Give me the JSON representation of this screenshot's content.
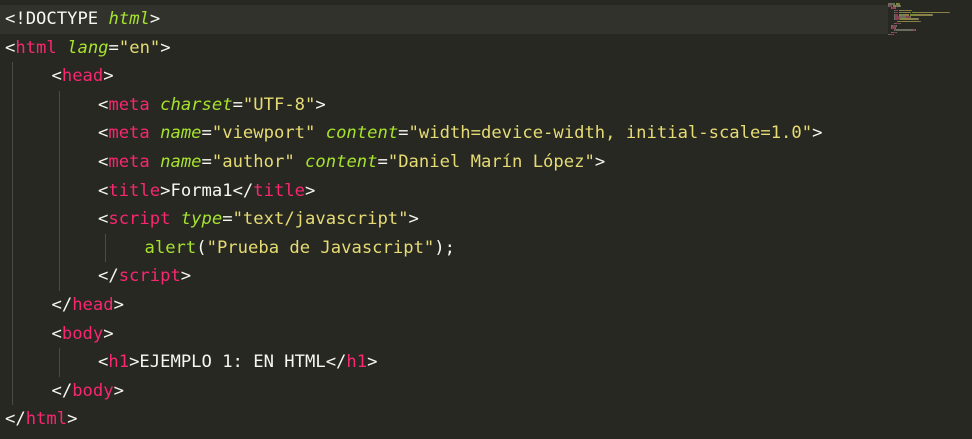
{
  "editor": {
    "language": "html",
    "theme_colors": {
      "background": "#272822",
      "tag": "#f92672",
      "attribute": "#a6e22e",
      "string": "#e6db74",
      "text": "#f8f8f2",
      "indent_guide": "#4a4b45"
    },
    "lines": [
      {
        "indent": 0,
        "tokens": [
          [
            "punct",
            "<"
          ],
          [
            "doctype",
            "!DOCTYPE"
          ],
          [
            "punct",
            " "
          ],
          [
            "attr",
            "html"
          ],
          [
            "punct",
            ">"
          ]
        ]
      },
      {
        "indent": 0,
        "tokens": [
          [
            "punct",
            "<"
          ],
          [
            "tag",
            "html"
          ],
          [
            "punct",
            " "
          ],
          [
            "attr",
            "lang"
          ],
          [
            "punct",
            "="
          ],
          [
            "str",
            "\"en\""
          ],
          [
            "punct",
            ">"
          ]
        ]
      },
      {
        "indent": 1,
        "tokens": [
          [
            "punct",
            "<"
          ],
          [
            "tag",
            "head"
          ],
          [
            "punct",
            ">"
          ]
        ]
      },
      {
        "indent": 2,
        "tokens": [
          [
            "punct",
            "<"
          ],
          [
            "tag",
            "meta"
          ],
          [
            "punct",
            " "
          ],
          [
            "attr",
            "charset"
          ],
          [
            "punct",
            "="
          ],
          [
            "str",
            "\"UTF-8\""
          ],
          [
            "punct",
            ">"
          ]
        ]
      },
      {
        "indent": 2,
        "tokens": [
          [
            "punct",
            "<"
          ],
          [
            "tag",
            "meta"
          ],
          [
            "punct",
            " "
          ],
          [
            "attr",
            "name"
          ],
          [
            "punct",
            "="
          ],
          [
            "str",
            "\"viewport\""
          ],
          [
            "punct",
            " "
          ],
          [
            "attr",
            "content"
          ],
          [
            "punct",
            "="
          ],
          [
            "str",
            "\"width=device-width, initial-scale=1.0\""
          ],
          [
            "punct",
            ">"
          ]
        ]
      },
      {
        "indent": 2,
        "tokens": [
          [
            "punct",
            "<"
          ],
          [
            "tag",
            "meta"
          ],
          [
            "punct",
            " "
          ],
          [
            "attr",
            "name"
          ],
          [
            "punct",
            "="
          ],
          [
            "str",
            "\"author\""
          ],
          [
            "punct",
            " "
          ],
          [
            "attr",
            "content"
          ],
          [
            "punct",
            "="
          ],
          [
            "str",
            "\"Daniel Marín López\""
          ],
          [
            "punct",
            ">"
          ]
        ]
      },
      {
        "indent": 2,
        "tokens": [
          [
            "punct",
            "<"
          ],
          [
            "tag",
            "title"
          ],
          [
            "punct",
            ">"
          ],
          [
            "text",
            "Forma1"
          ],
          [
            "punct",
            "</"
          ],
          [
            "tag",
            "title"
          ],
          [
            "punct",
            ">"
          ]
        ]
      },
      {
        "indent": 2,
        "tokens": [
          [
            "punct",
            "<"
          ],
          [
            "tag",
            "script"
          ],
          [
            "punct",
            " "
          ],
          [
            "attr",
            "type"
          ],
          [
            "punct",
            "="
          ],
          [
            "str",
            "\"text/javascript\""
          ],
          [
            "punct",
            ">"
          ]
        ]
      },
      {
        "indent": 3,
        "tokens": [
          [
            "func",
            "alert"
          ],
          [
            "punct",
            "("
          ],
          [
            "str",
            "\"Prueba de Javascript\""
          ],
          [
            "punct",
            ");"
          ]
        ]
      },
      {
        "indent": 2,
        "tokens": [
          [
            "punct",
            "</"
          ],
          [
            "tag",
            "script"
          ],
          [
            "punct",
            ">"
          ]
        ]
      },
      {
        "indent": 1,
        "tokens": [
          [
            "punct",
            "</"
          ],
          [
            "tag",
            "head"
          ],
          [
            "punct",
            ">"
          ]
        ]
      },
      {
        "indent": 1,
        "tokens": [
          [
            "punct",
            "<"
          ],
          [
            "tag",
            "body"
          ],
          [
            "punct",
            ">"
          ]
        ]
      },
      {
        "indent": 2,
        "tokens": [
          [
            "punct",
            "<"
          ],
          [
            "tag",
            "h1"
          ],
          [
            "punct",
            ">"
          ],
          [
            "text",
            "EJEMPLO 1: EN HTML"
          ],
          [
            "punct",
            "</"
          ],
          [
            "tag",
            "h1"
          ],
          [
            "punct",
            ">"
          ]
        ]
      },
      {
        "indent": 1,
        "tokens": [
          [
            "punct",
            "</"
          ],
          [
            "tag",
            "body"
          ],
          [
            "punct",
            ">"
          ]
        ]
      },
      {
        "indent": 0,
        "tokens": [
          [
            "punct",
            "</"
          ],
          [
            "tag",
            "html"
          ],
          [
            "punct",
            ">"
          ]
        ]
      }
    ]
  }
}
